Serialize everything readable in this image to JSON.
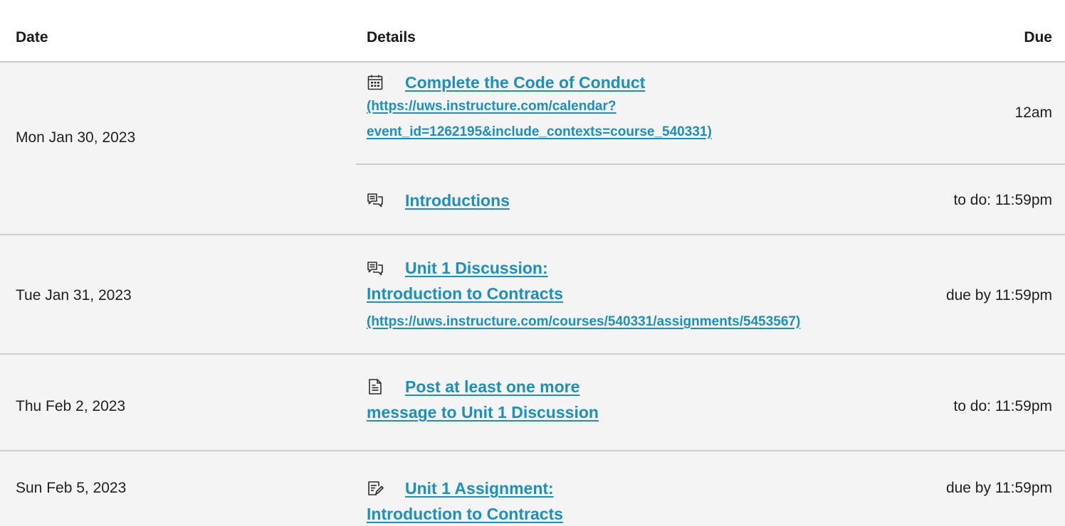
{
  "header": {
    "date": "Date",
    "details": "Details",
    "due": "Due"
  },
  "rows": [
    {
      "date": "Mon Jan 30, 2023",
      "items": [
        {
          "icon": "calendar-icon",
          "title": "Complete the Code of Conduct",
          "url_line1": "(https://uws.instructure.com/calendar?",
          "url_line2": "event_id=1262195&include_contexts=course_540331)",
          "due": "12am"
        },
        {
          "icon": "discussion-icon",
          "title": "Introductions",
          "due": "to do: 11:59pm"
        }
      ]
    },
    {
      "date": "Tue Jan 31, 2023",
      "items": [
        {
          "icon": "discussion-icon",
          "title_line1": "Unit 1 Discussion:",
          "title_line2": "Introduction to Contracts",
          "url": "(https://uws.instructure.com/courses/540331/assignments/5453567)",
          "due": "due by 11:59pm"
        }
      ]
    },
    {
      "date": "Thu Feb 2, 2023",
      "items": [
        {
          "icon": "page-icon",
          "title_line1": "Post at least one more",
          "title_line2": "message to Unit 1 Discussion",
          "due": "to do: 11:59pm"
        }
      ]
    },
    {
      "date": "Sun Feb 5, 2023",
      "items": [
        {
          "icon": "assignment-icon",
          "title_line1": "Unit 1 Assignment:",
          "title_line2": "Introduction to Contracts",
          "due": "due by 11:59pm"
        }
      ]
    }
  ]
}
